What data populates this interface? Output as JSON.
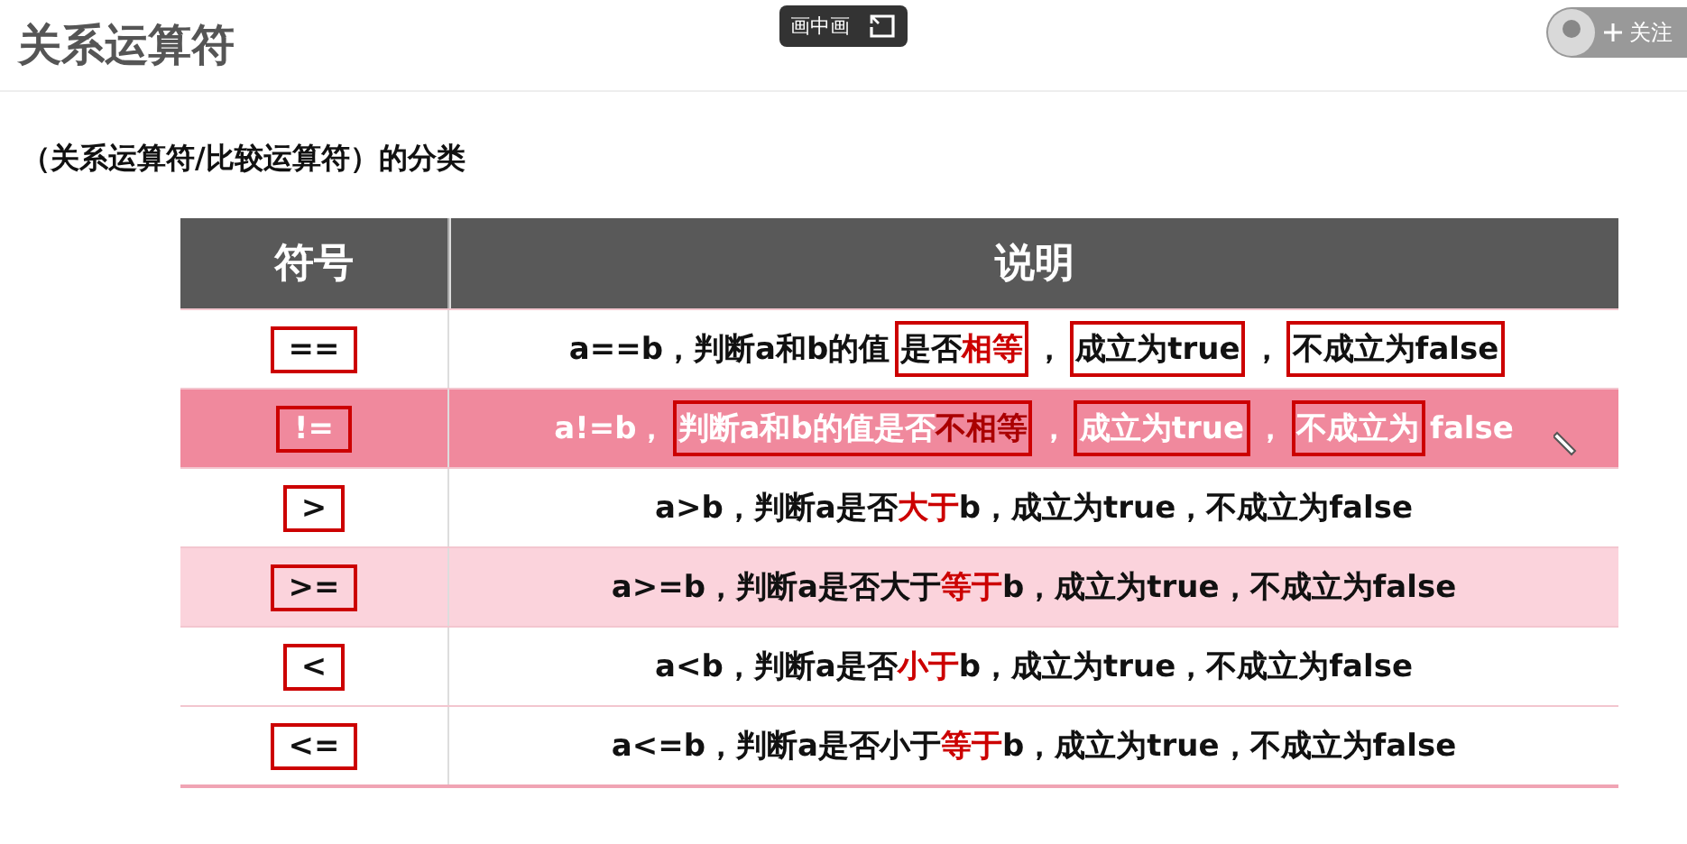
{
  "title": "关系运算符",
  "overlay": {
    "pip_button": "画中画",
    "follow_button": "关注"
  },
  "subtitle": "（关系运算符/比较运算符）的分类",
  "table": {
    "columns": [
      "符号",
      "说明"
    ],
    "rows": [
      {
        "kind": "plain",
        "symbol": "==",
        "groups": [
          {
            "boxed": false,
            "parts": [
              {
                "text": "a==b，判断a和b的值",
                "emphasis": false
              }
            ]
          },
          {
            "boxed": true,
            "parts": [
              {
                "text": "是否",
                "emphasis": false
              },
              {
                "text": "相等",
                "emphasis": true
              }
            ]
          },
          {
            "boxed": false,
            "parts": [
              {
                "text": "，",
                "emphasis": false
              }
            ]
          },
          {
            "boxed": true,
            "parts": [
              {
                "text": "成立为true",
                "emphasis": false
              }
            ]
          },
          {
            "boxed": false,
            "parts": [
              {
                "text": "，",
                "emphasis": false
              }
            ]
          },
          {
            "boxed": true,
            "parts": [
              {
                "text": "不成立为false",
                "emphasis": false
              }
            ]
          }
        ]
      },
      {
        "kind": "accent",
        "symbol": "!=",
        "groups": [
          {
            "boxed": false,
            "parts": [
              {
                "text": "a!=b，",
                "emphasis": false
              }
            ]
          },
          {
            "boxed": true,
            "parts": [
              {
                "text": "判断a和b的值是否",
                "emphasis": false
              },
              {
                "text": "不相等",
                "emphasis": true
              }
            ]
          },
          {
            "boxed": false,
            "parts": [
              {
                "text": "，",
                "emphasis": false
              }
            ]
          },
          {
            "boxed": true,
            "parts": [
              {
                "text": "成立为true",
                "emphasis": false
              }
            ]
          },
          {
            "boxed": false,
            "parts": [
              {
                "text": "，",
                "emphasis": false
              }
            ]
          },
          {
            "boxed": true,
            "parts": [
              {
                "text": "不成立为",
                "emphasis": false
              }
            ]
          },
          {
            "boxed": false,
            "parts": [
              {
                "text": "false",
                "emphasis": false
              }
            ]
          }
        ]
      },
      {
        "kind": "plain",
        "symbol": ">",
        "groups": [
          {
            "boxed": false,
            "parts": [
              {
                "text": "a>b，判断a是否",
                "emphasis": false
              },
              {
                "text": "大于",
                "emphasis": true
              },
              {
                "text": "b，成立为true，不成立为false",
                "emphasis": false
              }
            ]
          }
        ]
      },
      {
        "kind": "tint",
        "symbol": ">=",
        "groups": [
          {
            "boxed": false,
            "parts": [
              {
                "text": "a>=b，判断a是否大于",
                "emphasis": false
              },
              {
                "text": "等于",
                "emphasis": true
              },
              {
                "text": "b，成立为true，不成立为false",
                "emphasis": false
              }
            ]
          }
        ]
      },
      {
        "kind": "plain",
        "symbol": "<",
        "groups": [
          {
            "boxed": false,
            "parts": [
              {
                "text": "a<b，判断a是否",
                "emphasis": false
              },
              {
                "text": "小于",
                "emphasis": true
              },
              {
                "text": "b，成立为true，不成立为false",
                "emphasis": false
              }
            ]
          }
        ]
      },
      {
        "kind": "plain",
        "symbol": "<=",
        "groups": [
          {
            "boxed": false,
            "parts": [
              {
                "text": "a<=b，判断a是否小于",
                "emphasis": false
              },
              {
                "text": "等于",
                "emphasis": true
              },
              {
                "text": "b，成立为true，不成立为false",
                "emphasis": false
              }
            ]
          }
        ]
      }
    ]
  }
}
